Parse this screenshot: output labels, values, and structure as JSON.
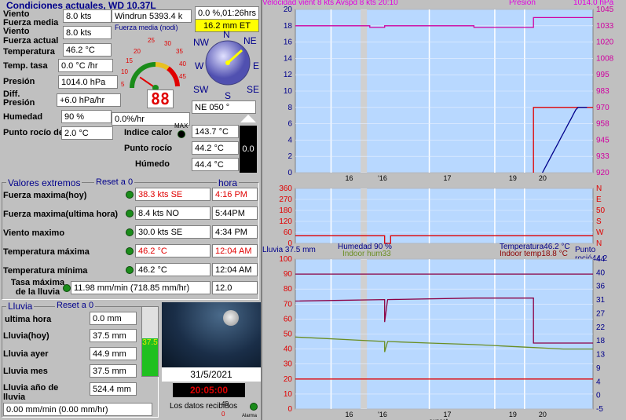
{
  "current": {
    "title": "Condiciones actuales, WD 10.37L",
    "rows": [
      {
        "label": "Viento",
        "value": "8.0 kts"
      },
      {
        "label": "Fuerza media Viento",
        "value": "8.0 kts"
      },
      {
        "label": "Fuerza actual",
        "value": ""
      },
      {
        "label": "Temperatura",
        "value": "46.2 °C"
      },
      {
        "label": "Temp. tasa",
        "value": "0.0 °C /hr"
      },
      {
        "label": "Presión",
        "value": "1014.0 hPa"
      },
      {
        "label": "Diff. Presión",
        "value": "+6.0 hPa/hr"
      },
      {
        "label": "Humedad",
        "value": "90 %"
      },
      {
        "label": "Punto rocío dep.",
        "value": "2.0 °C"
      }
    ],
    "windrun": "Windrun 5393.4 k",
    "gauge_label": "Fuerza media (nodi)",
    "gauge_ticks": [
      "5",
      "10",
      "15",
      "20",
      "25",
      "30",
      "35",
      "40",
      "45"
    ],
    "gauge_readout": "88",
    "gauge_value": 8.0,
    "clock_box": "0.0 %,01:26hrs",
    "et_box": "16.2 mm ET",
    "compass": {
      "N": "N",
      "NE": "NE",
      "E": "E",
      "SE": "SE",
      "S": "S",
      "SW": "SW",
      "W": "W",
      "NW": "NW"
    },
    "direction_box": "NE  050 °",
    "humidity_rate": "0.0%/hr",
    "max_label": "MAX",
    "extra_rows": [
      {
        "label": "Indice calor",
        "value": "143.7 °C"
      },
      {
        "label": "Punto rocío",
        "value": "44.2 °C"
      },
      {
        "label": "Húmedo",
        "value": "44.4 °C"
      }
    ],
    "black_box": "0.0"
  },
  "extremes": {
    "title": "Valores extremos",
    "reset": "Reset a 0",
    "hora": "hora",
    "rows": [
      {
        "label": "Fuerza maxima(hoy)",
        "value": "38.3 kts SE",
        "time": "4:16 PM",
        "red": true
      },
      {
        "label": "Fuerza maxima(ultima hora)",
        "value": "8.4 kts  NO",
        "time": "5:44PM",
        "red": false
      },
      {
        "label": "Viento maximo",
        "value": "30.0 kts SE",
        "time": "4:34 PM",
        "red": false
      },
      {
        "label": "Temperatura máxima",
        "value": "46.2 °C",
        "time": "12:04 AM",
        "red": true
      },
      {
        "label": "Temperatura mínima",
        "value": "46.2 °C",
        "time": "12:04 AM",
        "red": false
      }
    ],
    "rain_rate_label": "Tasa máxima de la lluvia",
    "rain_rate_value": "11.98 mm/min (718.85 mm/hr)",
    "rain_rate_time": "12.0"
  },
  "rain": {
    "title": "Lluvia",
    "reset": "Reset a 0",
    "rows": [
      {
        "label": "ultima hora",
        "value": "0.0 mm"
      },
      {
        "label": "Lluvia(hoy)",
        "value": "37.5 mm"
      },
      {
        "label": "Lluvia ayer",
        "value": "44.9 mm"
      },
      {
        "label": "Lluvia mes",
        "value": "37.5 mm"
      },
      {
        "label": "Lluvia año de lluvia",
        "value": "524.4 mm"
      }
    ],
    "rate": "0.00 mm/min (0.00 mm/hr)",
    "gauge_text": "37.5",
    "gauge_fill_fraction": 0.55
  },
  "sky": {
    "date": "31/5/2021",
    "time": "20:05:00",
    "received": "Los datos recibidos",
    "alarm": "Alarma",
    "count_top": "45",
    "count_bottom": "0"
  },
  "chart_data": [
    {
      "type": "line",
      "title": "Velocidad vient 8 kts  Avspd   8 kts   20:10",
      "right_title": "Presión",
      "right_value": "1014.0 hPa",
      "x_ticks": [
        "16",
        "'16",
        "17",
        "19",
        "20"
      ],
      "x_label": "sunset",
      "y_left": [
        0,
        2,
        4,
        6,
        8,
        10,
        12,
        14,
        16,
        18,
        20
      ],
      "y_right": [
        920,
        933,
        945,
        958,
        970,
        983,
        995,
        1008,
        1020,
        1033,
        1045
      ],
      "series": [
        {
          "name": "Presión",
          "color": "#d000a0",
          "points": [
            [
              0,
              18
            ],
            [
              0.25,
              18
            ],
            [
              0.25,
              17.8
            ],
            [
              0.3,
              17.8
            ],
            [
              0.3,
              18
            ],
            [
              0.6,
              18
            ],
            [
              0.6,
              17.8
            ],
            [
              0.8,
              17.8
            ],
            [
              0.8,
              19
            ],
            [
              1,
              19
            ]
          ]
        },
        {
          "name": "Velocidad vient",
          "color": "#e00000",
          "points": [
            [
              0.8,
              0
            ],
            [
              0.8,
              8
            ],
            [
              1,
              8
            ]
          ]
        }
      ]
    },
    {
      "type": "line",
      "y_left": [
        0,
        30,
        60,
        90,
        120,
        150,
        180,
        210,
        240,
        270,
        300,
        330,
        360
      ],
      "y_right": [
        "N",
        "W",
        "S",
        "50",
        "E",
        "N"
      ],
      "series": [
        {
          "name": "",
          "color": "#e00000",
          "points": [
            [
              0,
              50
            ],
            [
              0.3,
              50
            ],
            [
              0.3,
              0
            ],
            [
              0.32,
              0
            ],
            [
              0.32,
              50
            ],
            [
              1,
              50
            ]
          ]
        }
      ]
    },
    {
      "type": "line",
      "top_labels": [
        "Lluvia   37.5 mm",
        "Humedad 90 %",
        "Indoor hum33",
        "Temperatura46.2 °C",
        "Indoor temp18.8 °C",
        "Punto roció44.2"
      ],
      "x_ticks": [
        "16",
        "'16",
        "17",
        "19",
        "20"
      ],
      "x_label": "sunset",
      "y_left": [
        0,
        10,
        20,
        30,
        40,
        50,
        60,
        70,
        80,
        90,
        100
      ],
      "y_right": [
        -5,
        0,
        4,
        9,
        13,
        18,
        22,
        27,
        31,
        36,
        40,
        44
      ]
    }
  ],
  "colors": {
    "panel": "#c0c0c0",
    "plot": "#b8d8ff",
    "title_blue": "#00008b",
    "red": "#e00000",
    "magenta": "#d000a0"
  }
}
